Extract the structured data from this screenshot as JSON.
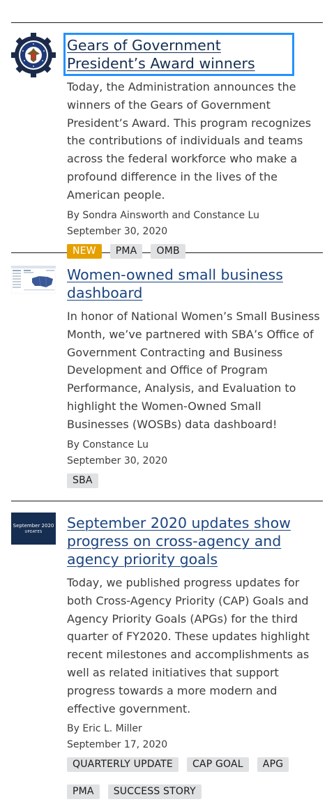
{
  "articles": [
    {
      "title": "Gears of Government President’s Award winners",
      "summary": "Today, the Administration announces the winners of the Gears of Government President’s Award. This program recognizes the contributions of individuals and teams across the federal workforce who make a profound difference in the lives of the American people.",
      "byline": "By Sondra Ainsworth and Constance Lu",
      "date": "September 30, 2020",
      "thumbnail_icon": "gears-of-government-seal-icon",
      "tags": [
        "NEW",
        "PMA",
        "OMB"
      ]
    },
    {
      "title": "Women-owned small business dashboard",
      "summary": "In honor of National Women’s Small Business Month, we’ve partnered with SBA’s Office of Government Contracting and Business Development and Office of Program Performance, Analysis, and Evaluation to highlight the Women-Owned Small Businesses (WOSBs) data dashboard!",
      "byline": "By Constance Lu",
      "date": "September 30, 2020",
      "thumbnail_icon": "dashboard-map-thumbnail-icon",
      "tags": [
        "SBA"
      ]
    },
    {
      "title": "September 2020 updates show progress on cross-agency and agency priority goals",
      "summary": "Today, we published progress updates for both Cross-Agency Priority (CAP) Goals and Agency Priority Goals (APGs) for the third quarter of FY2020. These updates highlight recent milestones and accomplishments as well as related initiatives that support progress towards a more modern and effective government.",
      "byline": "By Eric L. Miller",
      "date": "September 17, 2020",
      "thumbnail": {
        "line1": "September 2020",
        "line2": "UPDATES"
      },
      "tags": [
        "QUARTERLY UPDATE",
        "CAP GOAL",
        "APG",
        "PMA",
        "SUCCESS STORY"
      ]
    }
  ],
  "colors": {
    "link": "#1a4480",
    "focus_outline": "#2491ff",
    "new_tag": "#e5a000",
    "tag_bg": "#dfe1e2",
    "thumb_navy": "#162e51"
  }
}
